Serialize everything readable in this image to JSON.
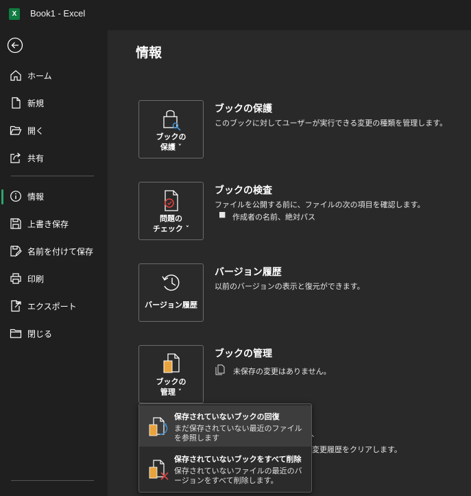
{
  "titlebar": {
    "app_icon": "excel-logo-icon",
    "logo_letter": "X",
    "title": "Book1  -  Excel"
  },
  "sidebar": {
    "back_icon": "back-arrow-icon",
    "items": [
      {
        "label": "ホーム",
        "icon": "home-icon"
      },
      {
        "label": "新規",
        "icon": "new-document-icon"
      },
      {
        "label": "開く",
        "icon": "open-folder-icon"
      },
      {
        "label": "共有",
        "icon": "share-icon"
      },
      {
        "label": "情報",
        "icon": "info-icon",
        "active": true
      },
      {
        "label": "上書き保存",
        "icon": "save-icon"
      },
      {
        "label": "名前を付けて保存",
        "icon": "save-as-icon"
      },
      {
        "label": "印刷",
        "icon": "print-icon"
      },
      {
        "label": "エクスポート",
        "icon": "export-icon"
      },
      {
        "label": "閉じる",
        "icon": "close-folder-icon"
      }
    ]
  },
  "main": {
    "title": "情報",
    "sections": [
      {
        "tile_label_1": "ブックの",
        "tile_label_2": "保護 ˅",
        "title": "ブックの保護",
        "desc": "このブックに対してユーザーが実行できる変更の種類を管理します。",
        "icon": "lock-key-icon"
      },
      {
        "tile_label_1": "問題の",
        "tile_label_2": "チェック ˅",
        "title": "ブックの検査",
        "desc": "ファイルを公開する前に、ファイルの次の項目を確認します。",
        "bullet": "作成者の名前、絶対パス",
        "icon": "inspect-document-icon"
      },
      {
        "tile_label_1": "バージョン履歴",
        "title": "バージョン履歴",
        "desc": "以前のバージョンの表示と復元ができます。",
        "icon": "history-clock-icon"
      },
      {
        "tile_label_1": "ブックの",
        "tile_label_2": "管理 ˅",
        "title": "ブックの管理",
        "desc": "未保存の変更はありません。",
        "icon": "manage-workbook-icon"
      }
    ],
    "partial_desc": "変更履歴をクリアします。",
    "partial_mark": "、"
  },
  "dropdown": {
    "items": [
      {
        "title": "保存されていないブックの回復",
        "desc": "まだ保存されていない最近のファイルを参照します",
        "icon": "recover-workbook-icon"
      },
      {
        "title": "保存されていないブックをすべて削除",
        "desc": "保存されていないファイルの最近のバージョンをすべて削除します。",
        "icon": "delete-workbooks-icon"
      }
    ]
  },
  "colors": {
    "accent": "#2fa66f",
    "excel_green": "#107c41",
    "background": "#292929",
    "sidebar": "#1f1f1f"
  }
}
